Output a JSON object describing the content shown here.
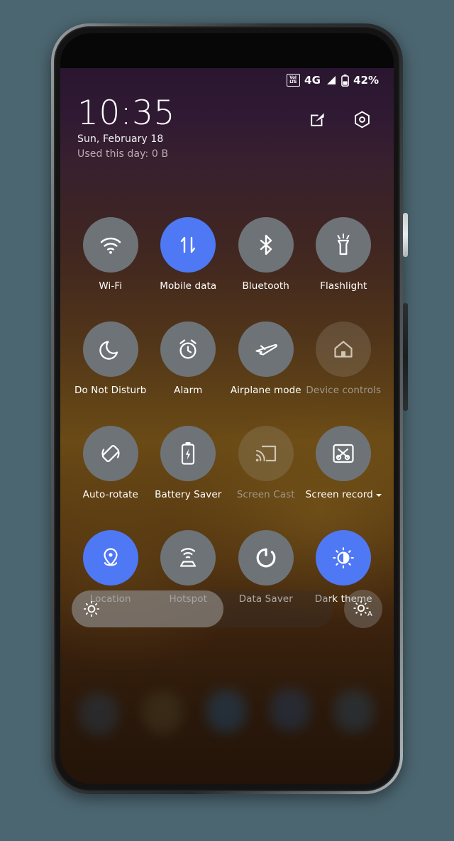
{
  "device": {
    "frame_name": "android-phone",
    "backdrop_color": "#4c6671",
    "hardware": {
      "front_camera": "front-camera",
      "proximity_sensor": "proximity-sensor",
      "earpiece": "earpiece-speaker",
      "power_button": "power-button",
      "volume_rocker": "volume-rocker"
    }
  },
  "status_bar": {
    "volte_top": "VoI",
    "volte_bottom": "LTE",
    "network_type": "4G",
    "signal_icon": "signal-bars-icon",
    "battery_icon": "battery-icon",
    "battery_percent": "42%"
  },
  "header": {
    "time": "10:35",
    "date": "Sun, February 18",
    "data_usage": "Used this day: 0 B",
    "edit_icon": "edit-icon",
    "settings_icon": "settings-gear-icon"
  },
  "tiles": [
    {
      "label": "Wi-Fi",
      "icon": "wifi-icon",
      "state": "off"
    },
    {
      "label": "Mobile data",
      "icon": "mobile-data-icon",
      "state": "on"
    },
    {
      "label": "Bluetooth",
      "icon": "bluetooth-icon",
      "state": "off"
    },
    {
      "label": "Flashlight",
      "icon": "flashlight-icon",
      "state": "off"
    },
    {
      "label": "Do Not Disturb",
      "icon": "moon-icon",
      "state": "off"
    },
    {
      "label": "Alarm",
      "icon": "alarm-clock-icon",
      "state": "off"
    },
    {
      "label": "Airplane mode",
      "icon": "airplane-icon",
      "state": "off"
    },
    {
      "label": "Device controls",
      "icon": "home-icon",
      "state": "disabled"
    },
    {
      "label": "Auto-rotate",
      "icon": "auto-rotate-icon",
      "state": "off"
    },
    {
      "label": "Battery Saver",
      "icon": "battery-saver-icon",
      "state": "off"
    },
    {
      "label": "Screen Cast",
      "icon": "screen-cast-icon",
      "state": "disabled"
    },
    {
      "label": "Screen record",
      "icon": "screen-record-icon",
      "state": "off",
      "has_dropdown": true
    },
    {
      "label": "Location",
      "icon": "location-pin-icon",
      "state": "on"
    },
    {
      "label": "Hotspot",
      "icon": "hotspot-icon",
      "state": "off"
    },
    {
      "label": "Data Saver",
      "icon": "data-saver-icon",
      "state": "off"
    },
    {
      "label": "Dark theme",
      "icon": "dark-theme-icon",
      "state": "on"
    }
  ],
  "brightness": {
    "slider_icon": "brightness-sun-icon",
    "level_percent": 58,
    "auto_button_icon": "auto-brightness-icon"
  },
  "colors": {
    "active_tile": "#4f78f5",
    "inactive_tile": "#6e7377",
    "disabled_label": "#a0988c",
    "text": "#ffffff"
  }
}
